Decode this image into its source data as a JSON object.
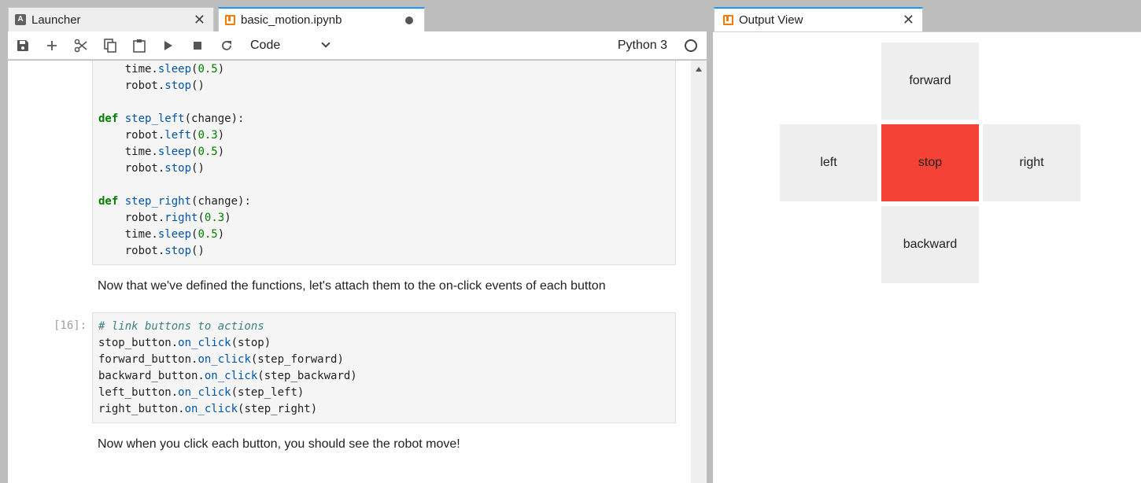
{
  "tabs": {
    "launcher": "Launcher",
    "notebook": "basic_motion.ipynb",
    "output": "Output View"
  },
  "toolbar": {
    "cell_type": "Code",
    "kernel": "Python 3",
    "icons": [
      "save-icon",
      "add-icon",
      "cut-icon",
      "copy-icon",
      "paste-icon",
      "run-icon",
      "stop-icon",
      "restart-icon"
    ]
  },
  "notebook": {
    "cell1_lines": [
      "    time.sleep(0.5)",
      "    robot.stop()",
      "",
      "def step_left(change):",
      "    robot.left(0.3)",
      "    time.sleep(0.5)",
      "    robot.stop()",
      "",
      "def step_right(change):",
      "    robot.right(0.3)",
      "    time.sleep(0.5)",
      "    robot.stop()"
    ],
    "markdown_1": "Now that we've defined the functions, let's attach them to the on-click events of each button",
    "cell2_prompt": "[16]:",
    "cell2_lines": [
      "# link buttons to actions",
      "stop_button.on_click(stop)",
      "forward_button.on_click(step_forward)",
      "backward_button.on_click(step_backward)",
      "left_button.on_click(step_left)",
      "right_button.on_click(step_right)"
    ],
    "markdown_2": "Now when you click each button, you should see the robot move!"
  },
  "output": {
    "forward": "forward",
    "left": "left",
    "stop": "stop",
    "right": "right",
    "backward": "backward",
    "stop_color": "#f44336",
    "button_color": "#eeeeee"
  }
}
